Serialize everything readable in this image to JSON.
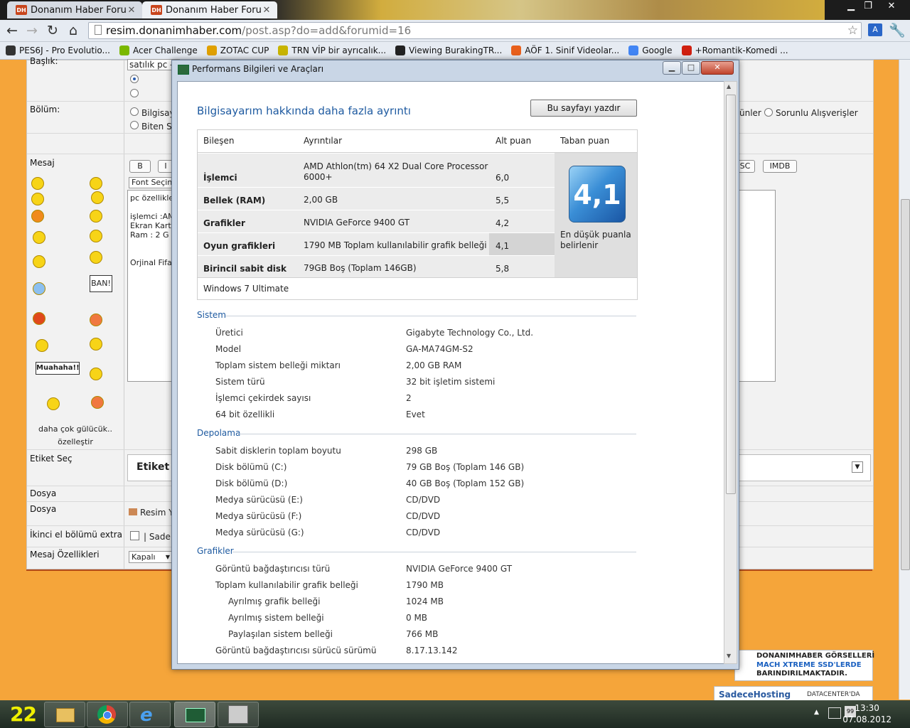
{
  "browser": {
    "tabs": [
      {
        "label": "Donanım Haber Forum",
        "favicon": "DH"
      },
      {
        "label": "Donanım Haber Forum",
        "favicon": "DH"
      }
    ],
    "url_host": "resim.donanimhaber.com",
    "url_path": "/post.asp?do=add&forumid=16",
    "bookmarks": [
      {
        "label": "PES6J - Pro Evolutio...",
        "color": "#333333"
      },
      {
        "label": "Acer Challenge",
        "color": "#7ab800"
      },
      {
        "label": "ZOTAC CUP",
        "color": "#e0a000"
      },
      {
        "label": "TRN VİP bir ayrıcalık...",
        "color": "#c8b400"
      },
      {
        "label": "Viewing BurakingTR...",
        "color": "#222222"
      },
      {
        "label": "AÖF 1. Sinif Videolar...",
        "color": "#e8601c"
      },
      {
        "label": "Google",
        "color": "#4285f4"
      },
      {
        "label": "+Romantik-Komedi ...",
        "color": "#d02010"
      }
    ]
  },
  "page": {
    "rows": {
      "baslik": "Başlık:",
      "bolum": "Bölüm:",
      "mesaj": "Mesaj",
      "etiket_sec": "Etiket Seç",
      "dosya1": "Dosya",
      "dosya2": "Dosya",
      "ikinci_el": "İkinci el bölümü extra",
      "mesaj_ozellikleri": "Mesaj Özellikleri"
    },
    "title_value": "satılık pc -",
    "bolum_opt1": "Bilgisay",
    "bolum_opt2": "Biten S",
    "bolum_right1": "ünler",
    "bolum_right2": "Sorunlu Alışverişler",
    "editor_buttons": {
      "b": "B",
      "i": "I",
      "sc": "SC",
      "imdb": "IMDB"
    },
    "font_select": "Font Seçin",
    "message_lines": [
      "pc özellikle",
      "",
      "işlemci :AM",
      "Ekran Kart",
      "Ram : 2 G",
      "",
      "",
      "Orjinal Fifa"
    ],
    "more_smileys": "daha çok gülücük..",
    "customize": "özelleştir",
    "sign_ban": "BAN!",
    "sign_muahaha": "Muahaha!!",
    "etiket_label": "Etiket",
    "resim_label": "Resim Y",
    "sade_label": "| Sade",
    "kapali": "Kapalı"
  },
  "dialog": {
    "title": "Performans Bilgileri ve Araçları",
    "heading": "Bilgisayarım hakkında daha fazla ayrıntı",
    "print_button": "Bu sayfayı yazdır",
    "wei": {
      "headers": [
        "Bileşen",
        "Ayrıntılar",
        "Alt puan",
        "Taban puan"
      ],
      "rows": [
        {
          "component": "İşlemci",
          "details": "AMD Athlon(tm) 64 X2 Dual Core Processor 6000+",
          "subscore": "6,0"
        },
        {
          "component": "Bellek (RAM)",
          "details": "2,00 GB",
          "subscore": "5,5"
        },
        {
          "component": "Grafikler",
          "details": "NVIDIA GeForce 9400 GT",
          "subscore": "4,2"
        },
        {
          "component": "Oyun grafikleri",
          "details": "1790 MB Toplam kullanılabilir grafik belleği",
          "subscore": "4,1"
        },
        {
          "component": "Birincil sabit disk",
          "details": "79GB Boş (Toplam 146GB)",
          "subscore": "5,8"
        }
      ],
      "base_score": "4,1",
      "base_caption": "En düşük puanla belirlenir",
      "os": "Windows 7 Ultimate"
    },
    "sections": [
      {
        "title": "Sistem",
        "items": [
          {
            "k": "Üretici",
            "v": "Gigabyte Technology Co., Ltd."
          },
          {
            "k": "Model",
            "v": "GA-MA74GM-S2"
          },
          {
            "k": "Toplam sistem belleği miktarı",
            "v": "2,00 GB RAM"
          },
          {
            "k": "Sistem türü",
            "v": "32 bit işletim sistemi"
          },
          {
            "k": "İşlemci çekirdek sayısı",
            "v": "2"
          },
          {
            "k": "64 bit özellikli",
            "v": "Evet"
          }
        ]
      },
      {
        "title": "Depolama",
        "items": [
          {
            "k": "Sabit disklerin toplam boyutu",
            "v": "298 GB"
          },
          {
            "k": "Disk bölümü (C:)",
            "v": "79 GB Boş (Toplam 146 GB)"
          },
          {
            "k": "Disk bölümü (D:)",
            "v": "40 GB Boş (Toplam 152 GB)"
          },
          {
            "k": "Medya sürücüsü (E:)",
            "v": "CD/DVD"
          },
          {
            "k": "Medya sürücüsü (F:)",
            "v": "CD/DVD"
          },
          {
            "k": "Medya sürücüsü (G:)",
            "v": "CD/DVD"
          }
        ]
      },
      {
        "title": "Grafikler",
        "items": [
          {
            "k": "Görüntü bağdaştırıcısı türü",
            "v": "NVIDIA GeForce 9400 GT"
          },
          {
            "k": "Toplam kullanılabilir grafik belleği",
            "v": "1790 MB"
          },
          {
            "k": "Ayrılmış grafik belleği",
            "v": "1024 MB",
            "indent": true
          },
          {
            "k": "Ayrılmış sistem belleği",
            "v": "0 MB",
            "indent": true
          },
          {
            "k": "Paylaşılan sistem belleği",
            "v": "766 MB",
            "indent": true
          },
          {
            "k": "Görüntü bağdaştırıcısı sürücü sürümü",
            "v": "8.17.13.142"
          }
        ]
      }
    ]
  },
  "ad": {
    "line1": "DONANIMHABER GÖRSELLERİ",
    "line2": "MACH XTREME SSD'LERDE",
    "line3": "BARINDIRILMAKTADIR.",
    "hosting": "SadeceHosting",
    "datacenter": "DATACENTER'DA"
  },
  "taskbar": {
    "widget": "22",
    "time": "13:30",
    "date": "07.08.2012"
  }
}
